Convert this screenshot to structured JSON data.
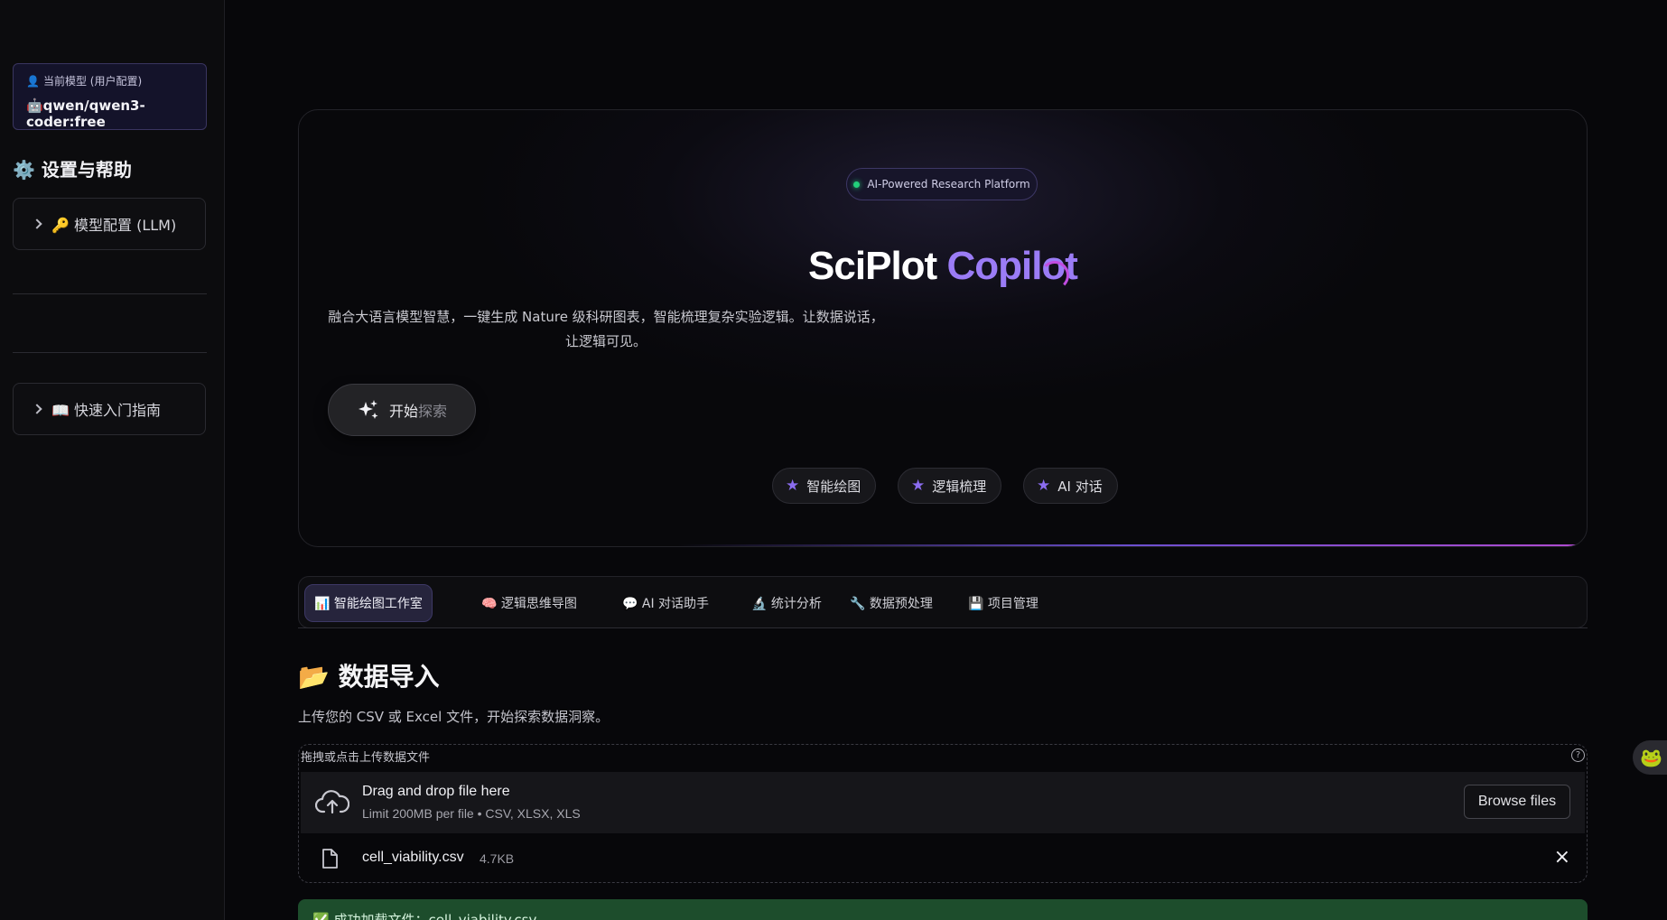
{
  "sidebar": {
    "model_card": {
      "label_icon": "👤",
      "label": "当前模型 (用户配置)",
      "value": "🤖qwen/qwen3-coder:free"
    },
    "heading": "⚙️ 设置与帮助",
    "expanders": [
      {
        "label": "🔑 模型配置 (LLM)"
      },
      {
        "label": "📖 快速入门指南"
      }
    ]
  },
  "hero": {
    "badge": "AI-Powered Research Platform",
    "title_part1": "SciPlot",
    "title_part2": "Copilot",
    "description": "融合大语言模型智慧，一键生成 Nature 级科研图表，智能梳理复杂实验逻辑。让数据说话，让逻辑可见。",
    "cta_label_main": "开始",
    "cta_label_faded": "探索",
    "chips": [
      "智能绘图",
      "逻辑梳理",
      "AI 对话"
    ]
  },
  "tabs": [
    {
      "label": "📊 智能绘图工作室",
      "active": true
    },
    {
      "label": "🧠 逻辑思维导图"
    },
    {
      "label": "💬 AI 对话助手"
    },
    {
      "label": "🔬 统计分析"
    },
    {
      "label": "🔧 数据预处理"
    },
    {
      "label": "💾 项目管理"
    }
  ],
  "section": {
    "title": "📂 数据导入",
    "description": "上传您的 CSV 或 Excel 文件，开始探索数据洞察。"
  },
  "uploader": {
    "label": "拖拽或点击上传数据文件",
    "help": "?",
    "drop_title": "Drag and drop file here",
    "drop_limit": "Limit 200MB per file • CSV, XLSX, XLS",
    "browse_label": "Browse files",
    "file": {
      "name": "cell_viability.csv",
      "size": "4.7KB"
    },
    "remove": "×"
  },
  "success_message": "✅ 成功加载文件：cell_viability.csv"
}
